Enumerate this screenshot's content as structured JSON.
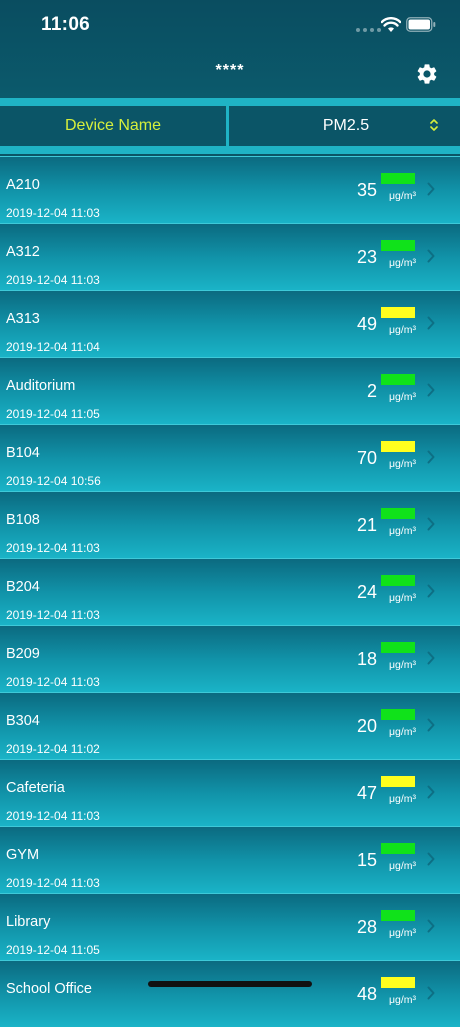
{
  "status_bar": {
    "time": "11:06"
  },
  "nav": {
    "title": "****"
  },
  "sort_bar": {
    "device_label": "Device Name",
    "metric_label": "PM2.5"
  },
  "colors": {
    "good": "#10e21a",
    "moderate": "#ffff1e",
    "accent": "#d6ef3c"
  },
  "devices": [
    {
      "name": "A210",
      "time": "2019-12-04 11:03",
      "value": "35",
      "unit": "μg/m³",
      "level": "good"
    },
    {
      "name": "A312",
      "time": "2019-12-04 11:03",
      "value": "23",
      "unit": "μg/m³",
      "level": "good"
    },
    {
      "name": "A313",
      "time": "2019-12-04 11:04",
      "value": "49",
      "unit": "μg/m³",
      "level": "moderate"
    },
    {
      "name": "Auditorium",
      "time": "2019-12-04 11:05",
      "value": "2",
      "unit": "μg/m³",
      "level": "good"
    },
    {
      "name": "B104",
      "time": "2019-12-04 10:56",
      "value": "70",
      "unit": "μg/m³",
      "level": "moderate"
    },
    {
      "name": "B108",
      "time": "2019-12-04 11:03",
      "value": "21",
      "unit": "μg/m³",
      "level": "good"
    },
    {
      "name": "B204",
      "time": "2019-12-04 11:03",
      "value": "24",
      "unit": "μg/m³",
      "level": "good"
    },
    {
      "name": "B209",
      "time": "2019-12-04 11:03",
      "value": "18",
      "unit": "μg/m³",
      "level": "good"
    },
    {
      "name": "B304",
      "time": "2019-12-04 11:02",
      "value": "20",
      "unit": "μg/m³",
      "level": "good"
    },
    {
      "name": "Cafeteria",
      "time": "2019-12-04 11:03",
      "value": "47",
      "unit": "μg/m³",
      "level": "moderate"
    },
    {
      "name": "GYM",
      "time": "2019-12-04 11:03",
      "value": "15",
      "unit": "μg/m³",
      "level": "good"
    },
    {
      "name": "Library",
      "time": "2019-12-04 11:05",
      "value": "28",
      "unit": "μg/m³",
      "level": "good"
    },
    {
      "name": "School Office",
      "time": "",
      "value": "48",
      "unit": "μg/m³",
      "level": "moderate"
    }
  ]
}
